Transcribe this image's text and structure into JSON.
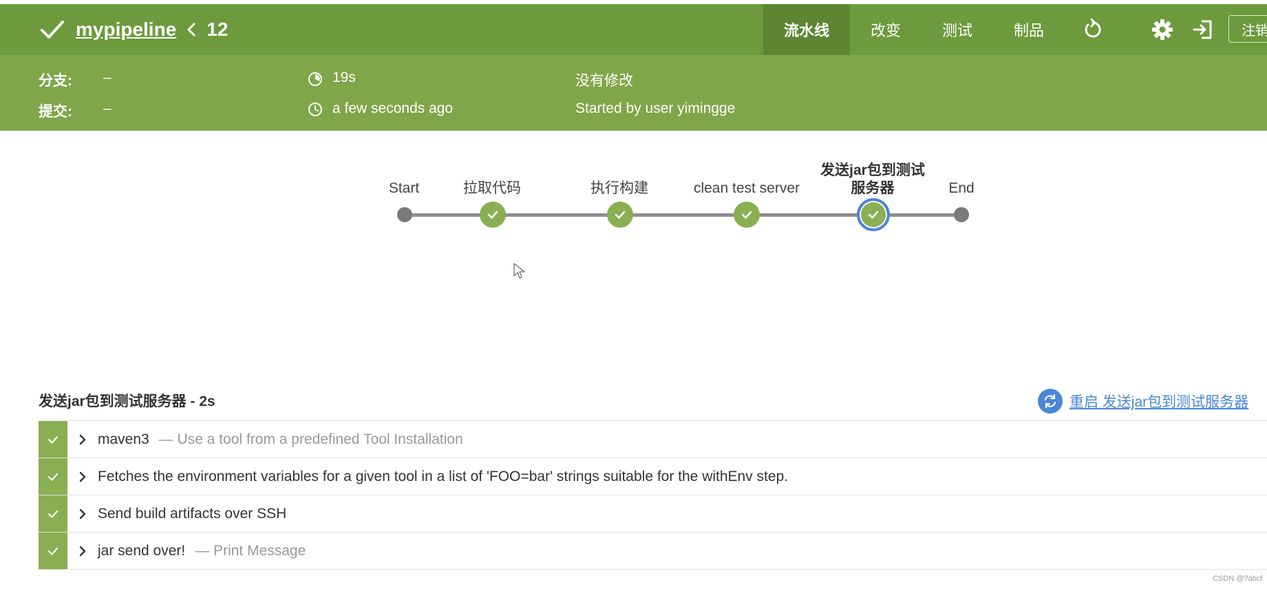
{
  "header": {
    "pipeline_name": "mypipeline",
    "build_number": "12",
    "nav": [
      "流水线",
      "改变",
      "测试",
      "制品"
    ],
    "logout_label": "注销",
    "icons": [
      "check-icon",
      "chevron-left-icon",
      "replay-icon",
      "gear-icon",
      "exit-icon"
    ]
  },
  "info": {
    "branch_label": "分支:",
    "branch_value": "–",
    "commit_label": "提交:",
    "commit_value": "–",
    "duration": "19s",
    "started_ago": "a few seconds ago",
    "changes": "没有修改",
    "started_by": "Started by user yimingge"
  },
  "stages": [
    {
      "label": "Start",
      "kind": "endpoint"
    },
    {
      "label": "拉取代码",
      "kind": "success"
    },
    {
      "label": "执行构建",
      "kind": "success"
    },
    {
      "label": "clean test server",
      "kind": "success"
    },
    {
      "label": "发送jar包到测试\n服务器",
      "kind": "success",
      "selected": true
    },
    {
      "label": "End",
      "kind": "endpoint"
    }
  ],
  "detail": {
    "title": "发送jar包到测试服务器 - 2s",
    "restart_label": "重启 发送jar包到测试服务器",
    "steps": [
      {
        "main": "maven3",
        "sub": "— Use a tool from a predefined Tool Installation"
      },
      {
        "main": "Fetches the environment variables for a given tool in a list of 'FOO=bar' strings suitable for the withEnv step.",
        "sub": ""
      },
      {
        "main": "Send build artifacts over SSH",
        "sub": ""
      },
      {
        "main": "jar send over!",
        "sub": "— Print Message"
      }
    ]
  },
  "watermark": "CSDN @?abcf",
  "colors": {
    "header_bg": "#6d9a3c",
    "info_bg": "#80a64a",
    "success": "#8aaf52",
    "link": "#4a86d6"
  }
}
